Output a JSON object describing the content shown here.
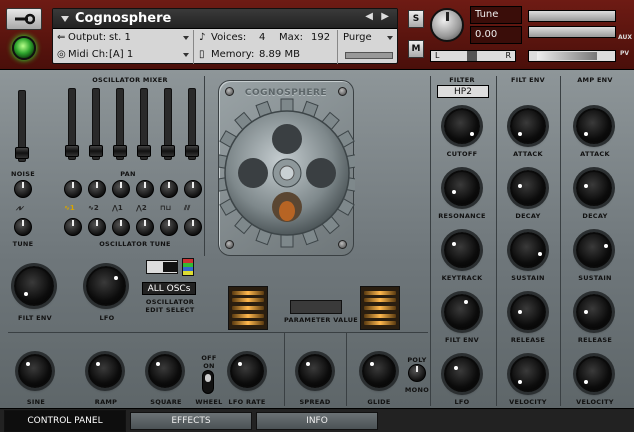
{
  "header": {
    "instrument_name": "Cognosphere",
    "output_label": "Output:",
    "output_value": "st. 1",
    "midi_label": "Midi Ch:",
    "midi_value": "[A] 1",
    "voices_label": "Voices:",
    "voices_value": "4",
    "max_label": "Max:",
    "max_value": "192",
    "memory_label": "Memory:",
    "memory_value": "8.89 MB",
    "purge_label": "Purge",
    "solo_label": "S",
    "mute_label": "M",
    "tune_label": "Tune",
    "tune_value": "0.00",
    "aux_label": "AUX",
    "pv_label": "PV",
    "pan_left": "L",
    "pan_right": "R"
  },
  "panel": {
    "oscillator_mixer": "OSCILLATOR MIXER",
    "noise": "NOISE",
    "pan": "PAN",
    "tune": "TUNE",
    "oscillator_tune": "OSCILLATOR TUNE",
    "filt_env": "FILT ENV",
    "lfo": "LFO",
    "all_oscs": "ALL OSCs",
    "osc_edit_select": "OSCILLATOR EDIT SELECT",
    "gear_title": "COGNOSPHERE",
    "parameter_value": "PARAMETER VALUE",
    "sine": "SINE",
    "ramp": "RAMP",
    "square": "SQUARE",
    "wheel": "WHEEL",
    "off_on": "OFF ON",
    "lfo_rate": "LFO RATE",
    "spread": "SPREAD",
    "glide": "GLIDE",
    "poly": "POLY",
    "mono": "MONO"
  },
  "filter": {
    "title": "FILTER",
    "type_value": "HP2",
    "cutoff": "CUTOFF",
    "resonance": "RESONANCE",
    "keytrack": "KEYTRACK",
    "filt_env": "FILT ENV",
    "lfo": "LFO"
  },
  "filt_env_col": {
    "title": "FILT ENV",
    "attack": "ATTACK",
    "decay": "DECAY",
    "sustain": "SUSTAIN",
    "release": "RELEASE",
    "velocity": "VELOCITY"
  },
  "amp_env_col": {
    "title": "AMP ENV",
    "attack": "ATTACK",
    "decay": "DECAY",
    "sustain": "SUSTAIN",
    "release": "RELEASE",
    "velocity": "VELOCITY"
  },
  "tabs": [
    "CONTROL PANEL",
    "EFFECTS",
    "INFO"
  ]
}
